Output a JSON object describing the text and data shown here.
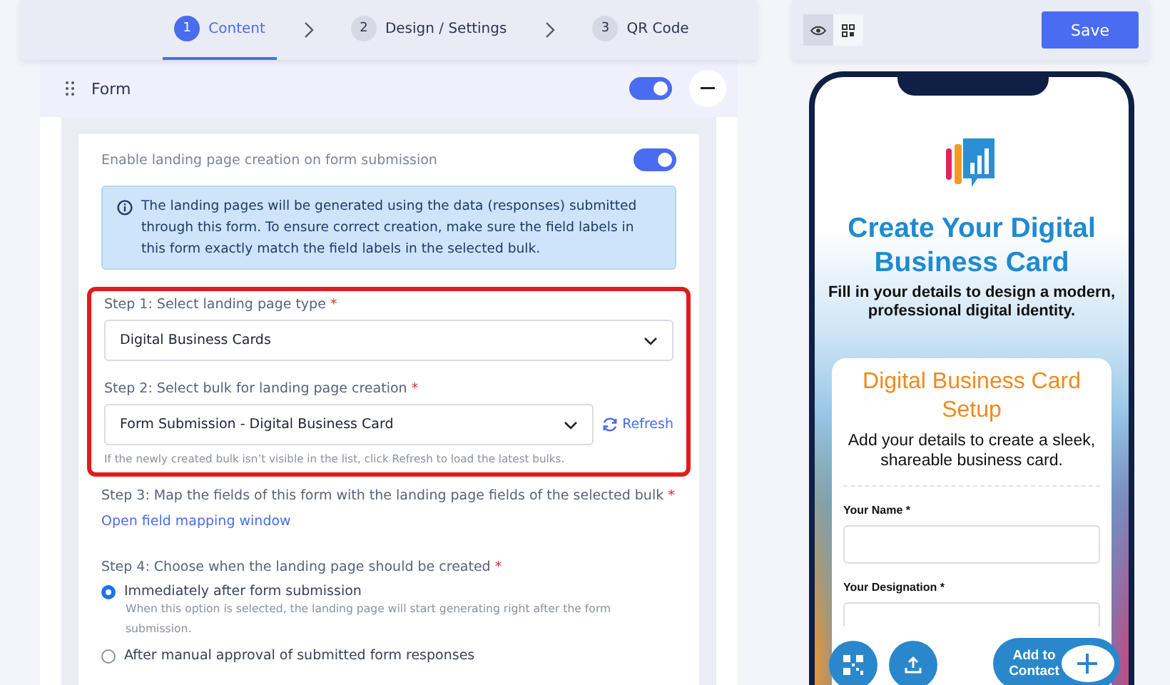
{
  "steps": [
    {
      "number": "1",
      "label": "Content",
      "selected": true
    },
    {
      "number": "2",
      "label": "Design / Settings",
      "selected": false
    },
    {
      "number": "3",
      "label": "QR Code",
      "selected": false
    }
  ],
  "form_section": {
    "title": "Form",
    "enabled": true
  },
  "landing_toggle": {
    "label": "Enable landing page creation on form submission",
    "on": true
  },
  "info": "The landing pages will be generated using the data (responses) submitted through this form. To ensure correct creation, make sure the field labels in this form exactly match the field labels in the selected bulk.",
  "highlighted": true,
  "step1": {
    "label": "Step 1: Select landing page type",
    "mark": "*",
    "value": "Digital Business Cards"
  },
  "step2": {
    "label": "Step 2: Select bulk for landing page creation",
    "mark": "*",
    "value": "Form Submission - Digital Business Card",
    "refresh": "Refresh",
    "hint": "If the newly created bulk isn’t visible in the list, click Refresh to load the latest bulks."
  },
  "step3": {
    "label": "Step 3: Map the fields of this form with the landing page fields of the selected bulk",
    "mark": "*",
    "link": "Open field mapping window"
  },
  "step4": {
    "label": "Step 4: Choose when the landing page should be created",
    "mark": "*",
    "options": [
      {
        "label": "Immediately after form submission",
        "description": "When this option is selected, the landing page will start generating right after the form submission.",
        "selected": true
      },
      {
        "label": "After manual approval of submitted form responses",
        "selected": false
      }
    ]
  },
  "preview": {
    "views": [
      {
        "kind": "eye",
        "selected": true
      },
      {
        "kind": "qr",
        "selected": false
      }
    ],
    "save": "Save",
    "phone": {
      "heading": "Create Your Digital Business Card",
      "subheading": "Fill in your details to design a modern, professional digital identity.",
      "card_title": "Digital Business Card Setup",
      "card_subtitle": "Add your details to create a sleek, shareable business card.",
      "fields": [
        "Your Name *",
        "Your Designation *"
      ],
      "add_contact": "Add to Contact"
    }
  }
}
